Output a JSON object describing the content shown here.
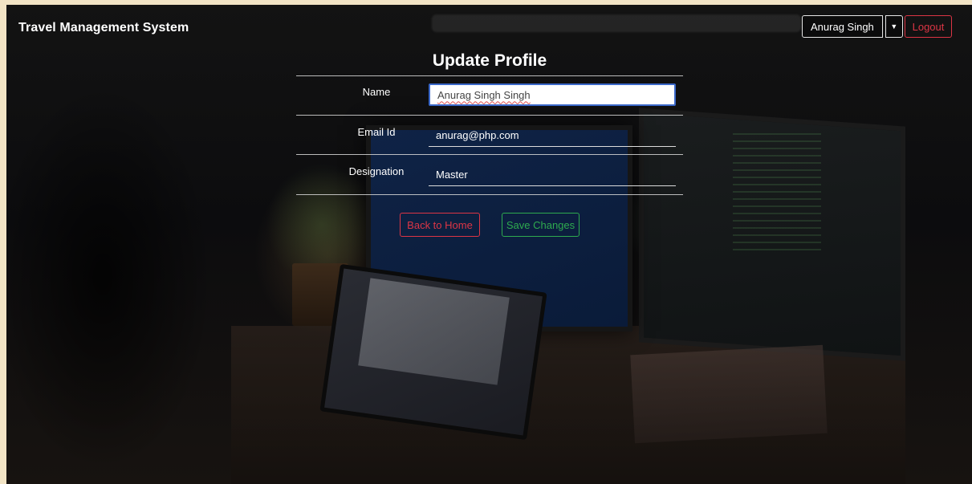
{
  "navbar": {
    "brand": "Travel Management System",
    "user_name": "Anurag Singh",
    "logout_label": "Logout"
  },
  "form": {
    "title": "Update Profile",
    "fields": [
      {
        "label": "Name",
        "value": "Anurag Singh Singh"
      },
      {
        "label": "Email Id",
        "value": "anurag@php.com"
      },
      {
        "label": "Designation",
        "value": "Master"
      }
    ],
    "back_label": "Back to Home",
    "save_label": "Save Changes"
  },
  "colors": {
    "danger": "#dc3545",
    "success": "#2eaa4f",
    "focus_border": "#3a68c9"
  },
  "icons": {
    "dropdown": "caret-down-icon"
  }
}
